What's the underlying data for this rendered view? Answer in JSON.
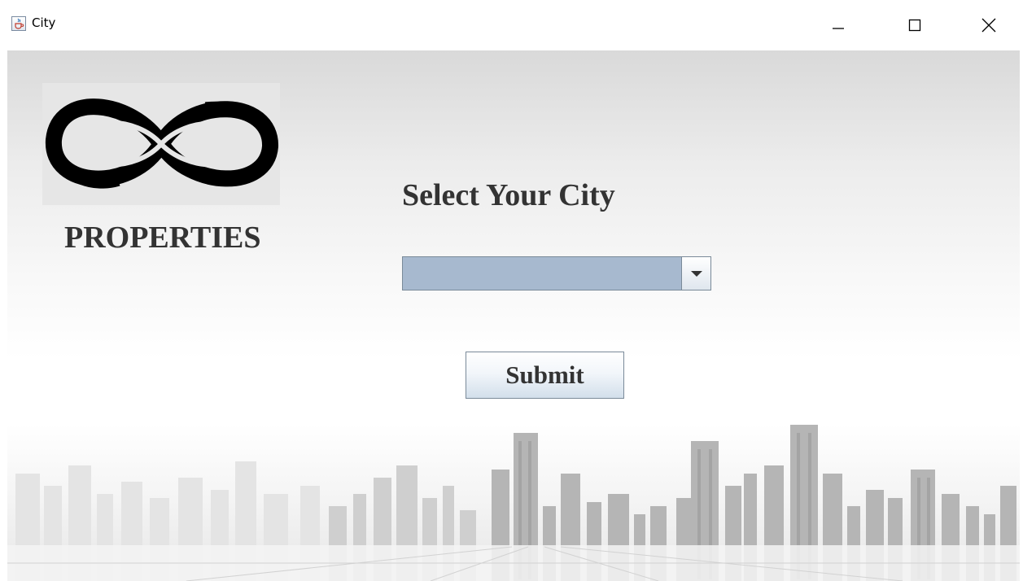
{
  "window": {
    "title": "City",
    "icon": "java-cup-icon",
    "controls": [
      "minimize-icon",
      "maximize-icon",
      "close-icon"
    ]
  },
  "branding": {
    "logo": "infinity-logo",
    "name": "PROPERTIES"
  },
  "form": {
    "heading": "Select Your City",
    "city_select": {
      "selected": ""
    },
    "submit_label": "Submit"
  },
  "colors": {
    "combo_background": "#a7b9cf",
    "text": "#333333",
    "button_gradient_bottom": "#d3dfeb"
  }
}
